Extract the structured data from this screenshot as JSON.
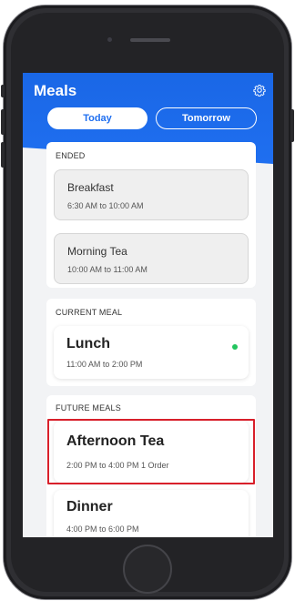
{
  "app": {
    "title": "Meals"
  },
  "tabs": {
    "today": "Today",
    "tomorrow": "Tomorrow"
  },
  "sections": {
    "ended": {
      "label": "ENDED",
      "meals": [
        {
          "name": "Breakfast",
          "time": "6:30 AM to 10:00 AM"
        },
        {
          "name": "Morning Tea",
          "time": "10:00 AM to 11:00 AM"
        }
      ]
    },
    "current": {
      "label": "CURRENT MEAL",
      "meals": [
        {
          "name": "Lunch",
          "time": "11:00 AM to 2:00 PM",
          "status_color": "#22c55e"
        }
      ]
    },
    "future": {
      "label": "FUTURE MEALS",
      "meals": [
        {
          "name": "Afternoon Tea",
          "time": "2:00 PM to 4:00 PM 1 Order"
        },
        {
          "name": "Dinner",
          "time": "4:00 PM to 6:00 PM"
        }
      ]
    }
  },
  "icons": {
    "settings": "gear-icon"
  },
  "colors": {
    "primary": "#1f6ff0",
    "highlight": "#d81f2a",
    "active_dot": "#22c55e"
  }
}
